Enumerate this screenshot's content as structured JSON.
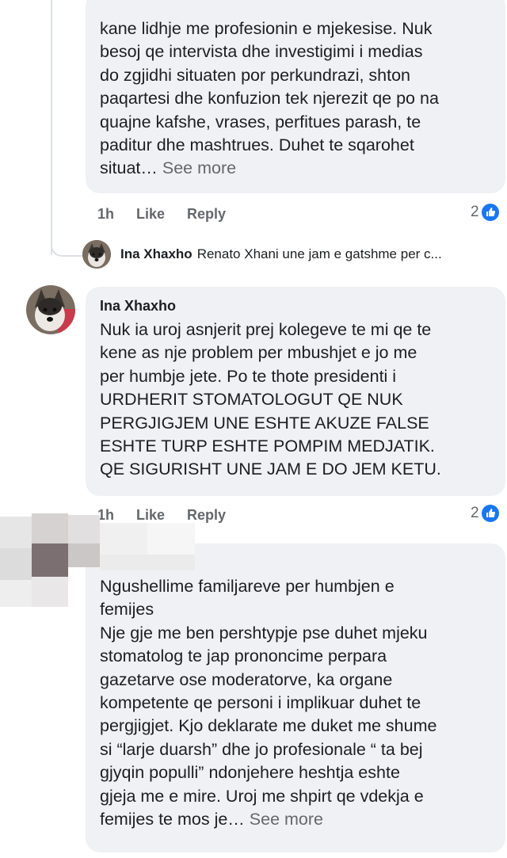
{
  "comment1": {
    "text": "kane lidhje me profesionin e mjekesise. Nuk\nbesoj qe intervista dhe investigimi i medias\ndo zgjidhi situaten por perkundrazi, shton\npaqartesi dhe konfuzion tek njerezit qe po na\nquajne kafshe, vrases, perfitues parash, te\npaditur dhe mashtrues. Duhet te sqarohet\nsituat…",
    "see_more": "See more",
    "time": "1h",
    "like": "Like",
    "reply": "Reply",
    "reaction_count": "2"
  },
  "reply_preview": {
    "author": "Ina Xhaxho",
    "text": "Renato Xhani une jam e gatshme per c..."
  },
  "comment2": {
    "author": "Ina Xhaxho",
    "text": "Nuk ia uroj asnjerit prej kolegeve te mi qe te\nkene as nje problem per mbushjet e jo me\nper humbje jete. Po te thote presidenti i\nURDHERIT STOMATOLOGUT QE NUK\nPERGJIGJEM UNE ESHTE AKUZE FALSE\nESHTE TURP ESHTE POMPIM MEDJATIK.\nQE SIGURISHT UNE JAM E DO JEM KETU.",
    "time": "1h",
    "like": "Like",
    "reply": "Reply",
    "reaction_count": "2"
  },
  "comment3": {
    "text": "Ngushellime familjareve per humbjen e\nfemijes\nNje gje me ben pershtypje pse duhet mjeku\nstomatolog te jap prononcime perpara\ngazetarve ose moderatorve, ka organe\nkompetente qe personi i implikuar duhet te\npergjigjet. Kjo deklarate me duket me shume\nsi “larje duarsh”  dhe jo profesionale “ ta bej\ngjyqin populli” ndonjehere heshtja eshte\ngjeja me e mire. Uroj me shpirt qe vdekja e\nfemijes te mos je…",
    "see_more": "See more"
  },
  "colors": {
    "bubble": "#eff1f4",
    "meta_text": "#65676b",
    "like_blue": "#1877f2"
  }
}
